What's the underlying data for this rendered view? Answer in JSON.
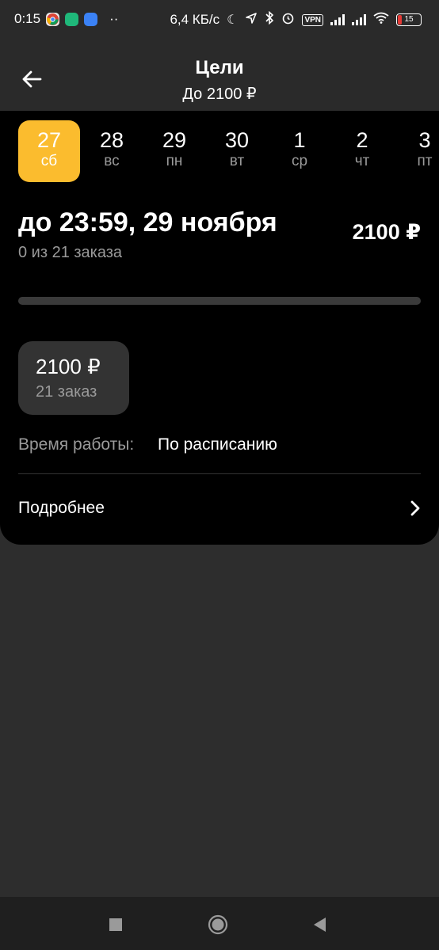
{
  "status_bar": {
    "time": "0:15",
    "dots": "··",
    "network_speed": "6,4 КБ/с",
    "vpn": "VPN",
    "battery": "15"
  },
  "header": {
    "title": "Цели",
    "subtitle": "До 2100 ₽"
  },
  "dates": [
    {
      "num": "27",
      "day": "сб",
      "active": true
    },
    {
      "num": "28",
      "day": "вс"
    },
    {
      "num": "29",
      "day": "пн"
    },
    {
      "num": "30",
      "day": "вт"
    },
    {
      "num": "1",
      "day": "ср"
    },
    {
      "num": "2",
      "day": "чт"
    },
    {
      "num": "3",
      "day": "пт"
    }
  ],
  "goal": {
    "deadline": "до 23:59, 29 ноября",
    "orders_progress": "0 из 21 заказа",
    "amount": "2100 ₽",
    "progress_fraction": 0
  },
  "chip": {
    "amount": "2100 ₽",
    "orders": "21 заказ"
  },
  "work_time": {
    "label": "Время работы:",
    "value": "По расписанию"
  },
  "more": {
    "label": "Подробнее"
  },
  "colors": {
    "accent": "#fbbc2e",
    "background": "#2d2d2d",
    "card": "#000000",
    "battery_low": "#e53935"
  }
}
